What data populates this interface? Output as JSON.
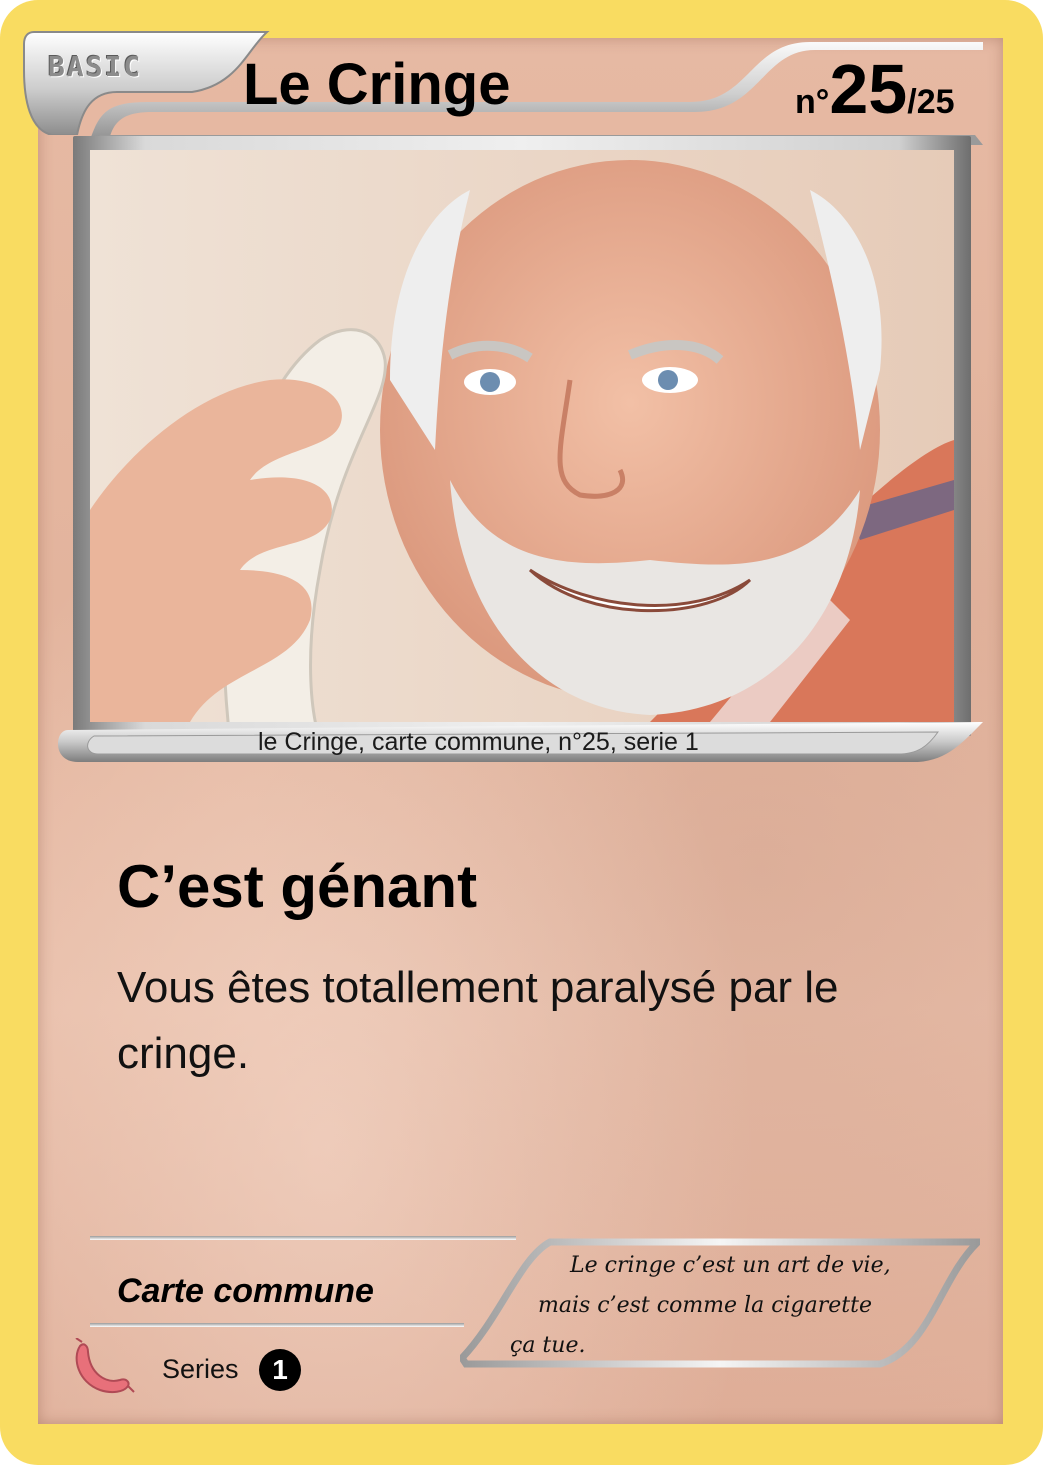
{
  "card": {
    "stage": "BASIC",
    "name": "Le Cringe",
    "number": {
      "prefix": "n°",
      "value": "25",
      "total": "/25"
    },
    "photo_caption": "le Cringe, carte commune, n°25, serie 1",
    "attack": {
      "name": "C’est génant",
      "description": "Vous êtes totallement paralysé par le cringe."
    },
    "rarity": "Carte commune",
    "flavor": {
      "line1": "Le cringe c’est un art de vie,",
      "line2": "mais c’est comme la cigarette",
      "line3": "ça tue."
    },
    "series": {
      "label": "Series",
      "value": "1"
    },
    "set_icon": "sausage-icon",
    "colors": {
      "border": "#f9dc61",
      "body": "#e6b9a3",
      "silver": "#d9d9d9"
    }
  }
}
